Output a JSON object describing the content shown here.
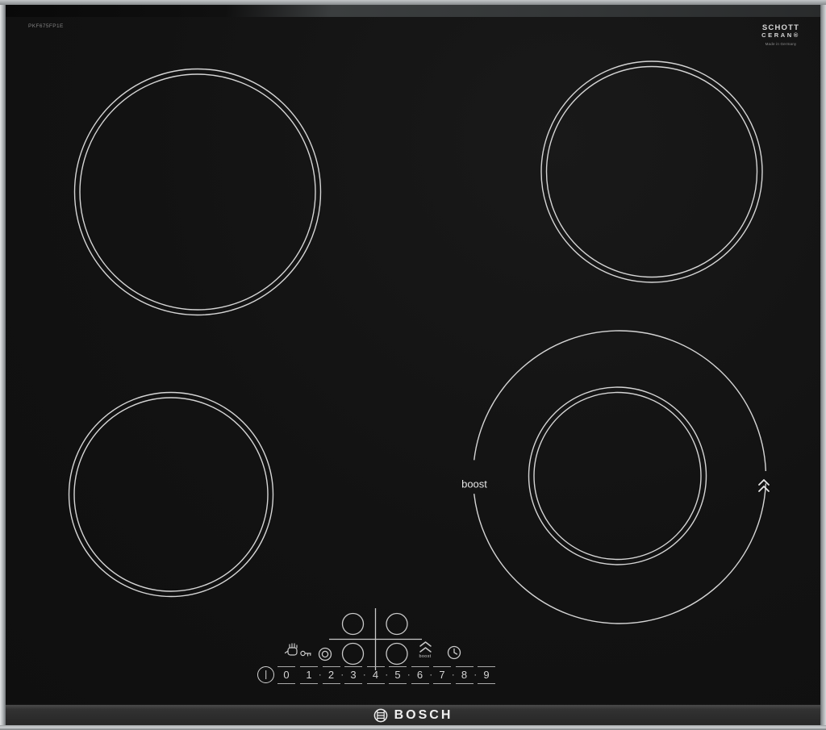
{
  "product": {
    "model_number": "PKF675FP1E",
    "brand_wordmark": "BOSCH"
  },
  "schott_logo": {
    "line1": "SCHOTT",
    "line2": "CERAN®",
    "subtext": "Made in Germany"
  },
  "zones": {
    "boost_zone_label": "boost"
  },
  "control_panel": {
    "levels": [
      "0",
      "1",
      "2",
      "3",
      "4",
      "5",
      "6",
      "7",
      "8",
      "9"
    ],
    "separator_dot": "·",
    "boost_key_label": "boost",
    "icon_names": {
      "power": "power-icon",
      "child_lock": "child-lock-icon",
      "dual_zone": "dual-zone-icon",
      "zone_selector": "zone-selector-cross",
      "boost": "double-chevron-up-icon",
      "timer": "timer-clock-icon",
      "bosch_emblem": "bosch-armature-icon"
    }
  },
  "colors": {
    "glass": "#121212",
    "ring": "#e6e6e6",
    "frame_light": "#d6d8d9",
    "bezel": "#2e2e2e",
    "control_text": "#d0d0d0",
    "model_text": "#828282"
  }
}
